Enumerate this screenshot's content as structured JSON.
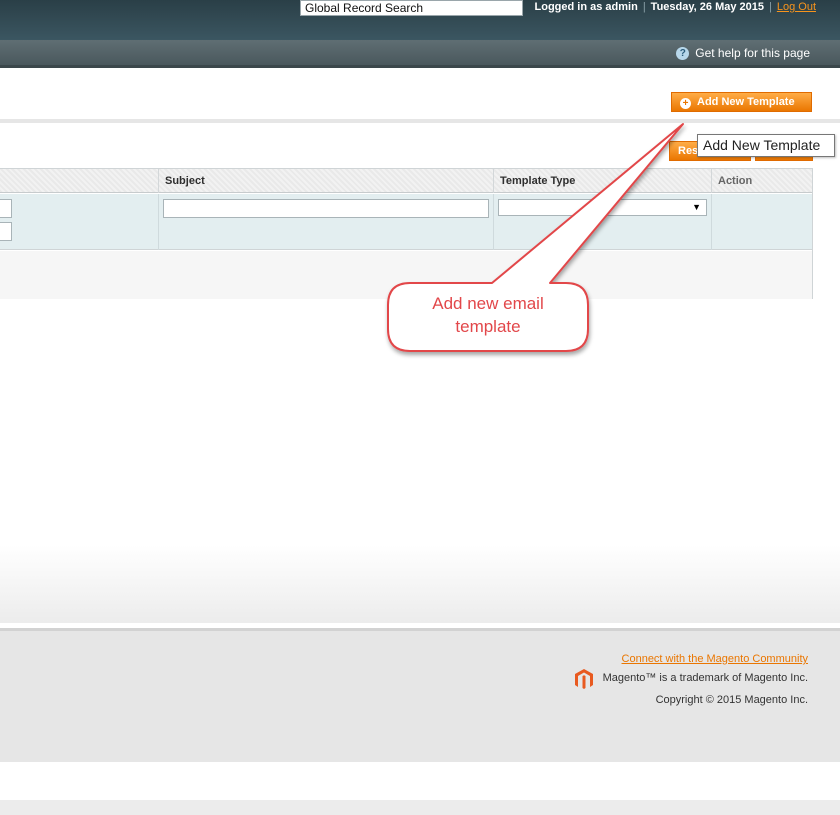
{
  "header": {
    "search_value": "Global Record Search",
    "logged_in": "Logged in as admin",
    "date": "Tuesday, 26 May 2015",
    "logout": "Log Out"
  },
  "navbar": {
    "help": "Get help for this page",
    "help_icon_glyph": "?"
  },
  "actions": {
    "add_new_template": "Add New Template",
    "plus_glyph": "+",
    "reset_partial": "Res",
    "tooltip": "Add New Template"
  },
  "grid": {
    "columns": [
      "Subject",
      "Template Type",
      "Action"
    ],
    "select_arrow": "▼"
  },
  "callout": {
    "line1": "Add new email",
    "line2": "template",
    "color": "#e2474a"
  },
  "footer": {
    "community_link": "Connect with the Magento Community",
    "trademark": "Magento™ is a trademark of Magento Inc.",
    "copyright": "Copyright © 2015 Magento Inc."
  },
  "colors": {
    "accent_orange": "#ea7601",
    "header_dark": "#2a3f47"
  }
}
